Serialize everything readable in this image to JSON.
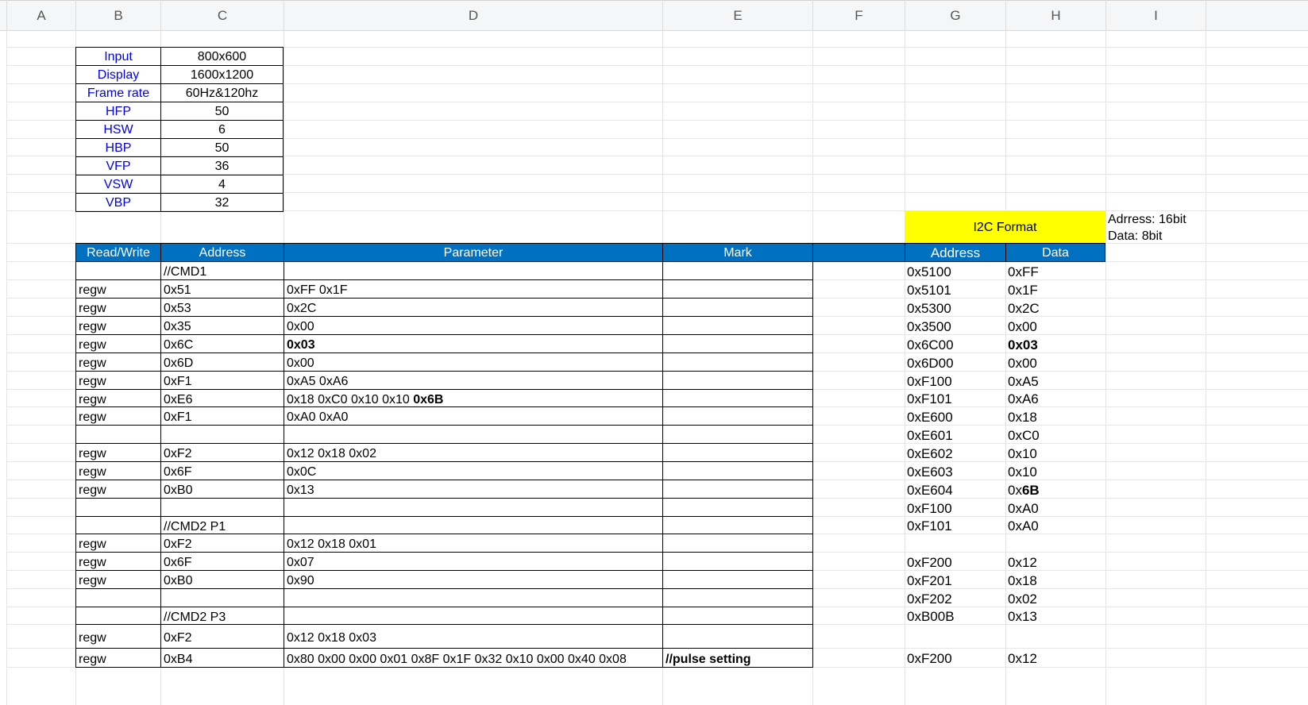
{
  "columns": [
    "A",
    "B",
    "C",
    "D",
    "E",
    "F",
    "G",
    "H",
    "I"
  ],
  "info_table": [
    {
      "label": "Input",
      "value": "800x600"
    },
    {
      "label": "Display",
      "value": "1600x1200"
    },
    {
      "label": "Frame rate",
      "value": "60Hz&120hz"
    },
    {
      "label": "HFP",
      "value": "50"
    },
    {
      "label": "HSW",
      "value": "6"
    },
    {
      "label": "HBP",
      "value": "50"
    },
    {
      "label": "VFP",
      "value": "36"
    },
    {
      "label": "VSW",
      "value": "4"
    },
    {
      "label": "VBP",
      "value": "32"
    }
  ],
  "i2c": {
    "title": "I2C Format",
    "note1": "Adrress: 16bit",
    "note2": "Data: 8bit",
    "col_address": "Address",
    "col_data": "Data"
  },
  "cmd_header": {
    "rw": "Read/Write",
    "address": "Address",
    "parameter": "Parameter",
    "mark": "Mark"
  },
  "cmd_rows": [
    {
      "rw": "",
      "addr": "//CMD1",
      "param": "",
      "param_bold": "",
      "mark": ""
    },
    {
      "rw": "regw",
      "addr": "0x51",
      "param": "0xFF 0x1F",
      "param_bold": "",
      "mark": ""
    },
    {
      "rw": "regw",
      "addr": "0x53",
      "param": "0x2C",
      "param_bold": "",
      "mark": ""
    },
    {
      "rw": "regw",
      "addr": "0x35",
      "param": "0x00",
      "param_bold": "",
      "mark": ""
    },
    {
      "rw": "regw",
      "addr": "0x6C",
      "param": "",
      "param_bold": "0x03",
      "mark": ""
    },
    {
      "rw": "regw",
      "addr": "0x6D",
      "param": "0x00",
      "param_bold": "",
      "mark": ""
    },
    {
      "rw": "regw",
      "addr": "0xF1",
      "param": "0xA5 0xA6",
      "param_bold": "",
      "mark": ""
    },
    {
      "rw": "regw",
      "addr": "0xE6",
      "param": "0x18 0xC0 0x10 0x10 ",
      "param_bold": "0x6B",
      "mark": ""
    },
    {
      "rw": "regw",
      "addr": "0xF1",
      "param": "0xA0 0xA0",
      "param_bold": "",
      "mark": ""
    },
    {
      "rw": "",
      "addr": "",
      "param": "",
      "param_bold": "",
      "mark": ""
    },
    {
      "rw": "regw",
      "addr": "0xF2",
      "param": "0x12 0x18 0x02",
      "param_bold": "",
      "mark": ""
    },
    {
      "rw": "regw",
      "addr": "0x6F",
      "param": "0x0C",
      "param_bold": "",
      "mark": ""
    },
    {
      "rw": "regw",
      "addr": "0xB0",
      "param": "0x13",
      "param_bold": "",
      "mark": ""
    },
    {
      "rw": "",
      "addr": "",
      "param": "",
      "param_bold": "",
      "mark": ""
    },
    {
      "rw": "",
      "addr": "//CMD2 P1",
      "param": "",
      "param_bold": "",
      "mark": ""
    },
    {
      "rw": "regw",
      "addr": "0xF2",
      "param": "0x12 0x18 0x01",
      "param_bold": "",
      "mark": ""
    },
    {
      "rw": "regw",
      "addr": "0x6F",
      "param": "0x07",
      "param_bold": "",
      "mark": ""
    },
    {
      "rw": "regw",
      "addr": "0xB0",
      "param": "0x90",
      "param_bold": "",
      "mark": ""
    },
    {
      "rw": "",
      "addr": "",
      "param": "",
      "param_bold": "",
      "mark": ""
    },
    {
      "rw": "",
      "addr": "//CMD2 P3",
      "param": "",
      "param_bold": "",
      "mark": ""
    },
    {
      "rw": "regw",
      "addr": "0xF2",
      "param": "0x12 0x18 0x03",
      "param_bold": "",
      "mark": ""
    },
    {
      "rw": "regw",
      "addr": "0xB4",
      "param": "0x80 0x00 0x00 0x01 0x8F 0x1F 0x32 0x10 0x00 0x40 0x08",
      "param_bold": "",
      "mark": "//pulse setting"
    }
  ],
  "i2c_rows": [
    {
      "addr": "0x5100",
      "data": "0xFF",
      "data_prefix": "",
      "data_bold": ""
    },
    {
      "addr": "0x5101",
      "data": "0x1F",
      "data_prefix": "",
      "data_bold": ""
    },
    {
      "addr": "0x5300",
      "data": "0x2C",
      "data_prefix": "",
      "data_bold": ""
    },
    {
      "addr": "0x3500",
      "data": "0x00",
      "data_prefix": "",
      "data_bold": ""
    },
    {
      "addr": "0x6C00",
      "data": "",
      "data_prefix": "",
      "data_bold": "0x03"
    },
    {
      "addr": "0x6D00",
      "data": "0x00",
      "data_prefix": "",
      "data_bold": ""
    },
    {
      "addr": "0xF100",
      "data": "0xA5",
      "data_prefix": "",
      "data_bold": ""
    },
    {
      "addr": "0xF101",
      "data": "0xA6",
      "data_prefix": "",
      "data_bold": ""
    },
    {
      "addr": "0xE600",
      "data": "0x18",
      "data_prefix": "",
      "data_bold": ""
    },
    {
      "addr": "0xE601",
      "data": "0xC0",
      "data_prefix": "",
      "data_bold": ""
    },
    {
      "addr": "0xE602",
      "data": "0x10",
      "data_prefix": "",
      "data_bold": ""
    },
    {
      "addr": "0xE603",
      "data": "0x10",
      "data_prefix": "",
      "data_bold": ""
    },
    {
      "addr": "0xE604",
      "data": "",
      "data_prefix": "0x",
      "data_bold": "6B"
    },
    {
      "addr": "0xF100",
      "data": "0xA0",
      "data_prefix": "",
      "data_bold": ""
    },
    {
      "addr": "0xF101",
      "data": "0xA0",
      "data_prefix": "",
      "data_bold": ""
    },
    {
      "addr": "",
      "data": "",
      "data_prefix": "",
      "data_bold": ""
    },
    {
      "addr": "0xF200",
      "data": "0x12",
      "data_prefix": "",
      "data_bold": ""
    },
    {
      "addr": "0xF201",
      "data": "0x18",
      "data_prefix": "",
      "data_bold": ""
    },
    {
      "addr": "0xF202",
      "data": "0x02",
      "data_prefix": "",
      "data_bold": ""
    },
    {
      "addr": "0xB00B",
      "data": "0x13",
      "data_prefix": "",
      "data_bold": ""
    },
    {
      "addr": "",
      "data": "",
      "data_prefix": "",
      "data_bold": ""
    },
    {
      "addr": "0xF200",
      "data": "0x12",
      "data_prefix": "",
      "data_bold": ""
    }
  ],
  "colors": {
    "header_blue": "#0070c0",
    "i2c_yellow": "#ffff00",
    "label_blue": "#0000ee"
  }
}
